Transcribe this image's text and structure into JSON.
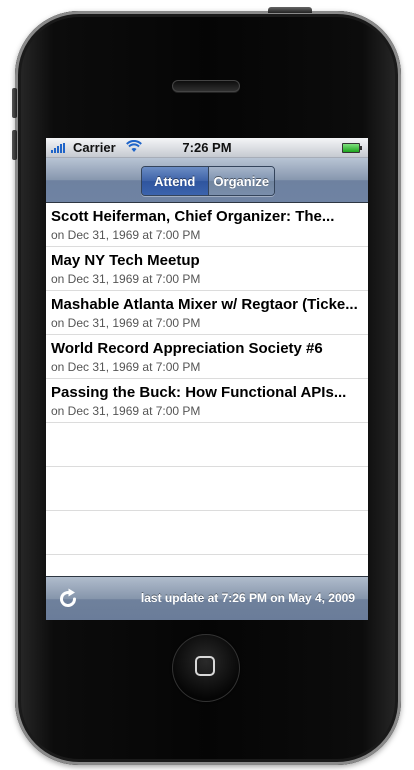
{
  "status_bar": {
    "carrier": "Carrier",
    "time": "7:26 PM"
  },
  "nav": {
    "segments": [
      {
        "label": "Attend",
        "selected": true
      },
      {
        "label": "Organize",
        "selected": false
      }
    ]
  },
  "events": [
    {
      "title": "Scott Heiferman, Chief Organizer:  The...",
      "subtitle": "on Dec 31, 1969 at 7:00 PM"
    },
    {
      "title": "May NY Tech Meetup",
      "subtitle": "on Dec 31, 1969 at 7:00 PM"
    },
    {
      "title": "Mashable Atlanta Mixer w/ Regtaor (Ticke...",
      "subtitle": "on Dec 31, 1969 at 7:00 PM"
    },
    {
      "title": "World Record Appreciation Society #6",
      "subtitle": "on Dec 31, 1969 at 7:00 PM"
    },
    {
      "title": "Passing the Buck: How Functional APIs...",
      "subtitle": "on Dec 31, 1969 at 7:00 PM"
    }
  ],
  "toolbar": {
    "refresh_icon": "refresh-icon",
    "last_update": "last update at 7:26 PM on May 4, 2009"
  },
  "colors": {
    "accent": "#3e62a8",
    "bar_blue": "#6f83a3"
  }
}
